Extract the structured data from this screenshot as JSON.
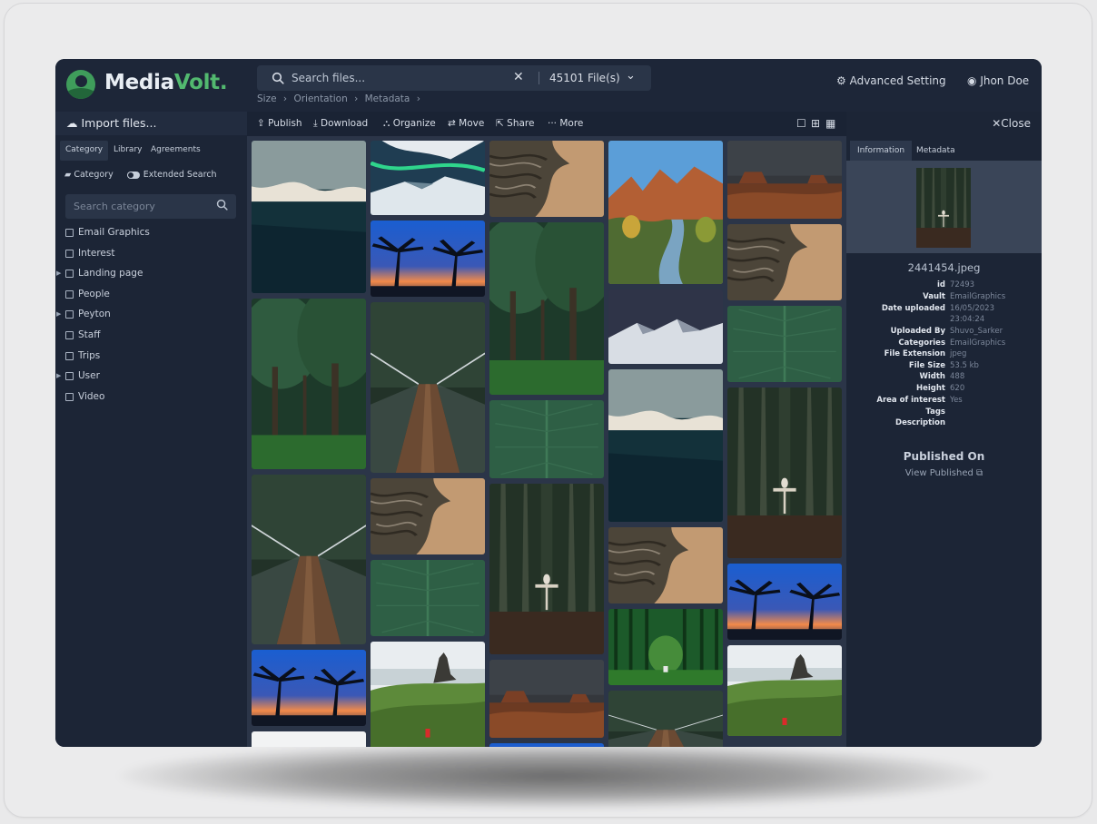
{
  "brand": {
    "part1": "Media",
    "part2": "Volt."
  },
  "search": {
    "placeholder": "Search files...",
    "count": "45101 File(s)"
  },
  "breadcrumbs": [
    "Size",
    "Orientation",
    "Metadata"
  ],
  "header": {
    "advanced": "Advanced Setting",
    "user": "Jhon Doe"
  },
  "sidebar": {
    "import": "Import files...",
    "tabs": [
      "Category",
      "Library",
      "Agreements"
    ],
    "category_label": "Category",
    "extended": "Extended Search",
    "search_placeholder": "Search category",
    "items": [
      {
        "label": "Email Graphics",
        "expandable": false
      },
      {
        "label": "Interest",
        "expandable": false
      },
      {
        "label": "Landing page",
        "expandable": true
      },
      {
        "label": "People",
        "expandable": false
      },
      {
        "label": "Peyton",
        "expandable": true
      },
      {
        "label": "Staff",
        "expandable": false
      },
      {
        "label": "Trips",
        "expandable": false
      },
      {
        "label": "User",
        "expandable": true
      },
      {
        "label": "Video",
        "expandable": false
      }
    ]
  },
  "toolbar": {
    "publish": "Publish",
    "download": "Download",
    "organize": "Organize",
    "move": "Move",
    "share": "Share",
    "more": "More"
  },
  "info": {
    "close": "Close",
    "tabs": [
      "Information",
      "Metadata"
    ],
    "filename": "2441454.jpeg",
    "fields": [
      {
        "k": "id",
        "v": "72493"
      },
      {
        "k": "Vault",
        "v": "EmailGraphics"
      },
      {
        "k": "Date uploaded",
        "v": "16/05/2023"
      },
      {
        "k": "",
        "v": "23:04:24"
      },
      {
        "k": "Uploaded By",
        "v": "Shuvo_Sarker"
      },
      {
        "k": "Categories",
        "v": "EmailGraphics"
      },
      {
        "k": "File Extension",
        "v": "jpeg"
      },
      {
        "k": "File Size",
        "v": "53.5 kb"
      },
      {
        "k": "Width",
        "v": "488"
      },
      {
        "k": "Height",
        "v": "620"
      },
      {
        "k": "Area of interest",
        "v": "Yes"
      },
      {
        "k": "Tags",
        "v": ""
      },
      {
        "k": "Description",
        "v": ""
      }
    ],
    "published_on": "Published On",
    "view_published": "View Published"
  },
  "gallery": {
    "columns": [
      [
        "aerial-ocean",
        "tree-park",
        "rope-bridge",
        "palm-sunset",
        "white"
      ],
      [
        "arctic-aurora",
        "palm-sunset",
        "rope-bridge",
        "desert-rock",
        "leaf",
        "mountain-hill"
      ],
      [
        "desert-rock",
        "tree-park",
        "leaf",
        "forest-person",
        "canyon",
        "palm-sunset"
      ],
      [
        "zion-river",
        "snow-peaks",
        "aerial-ocean",
        "desert-rock",
        "green-forest",
        "rope-bridge"
      ],
      [
        "canyon",
        "desert-rock",
        "leaf",
        "forest-person",
        "palm-sunset",
        "mountain-hill"
      ]
    ]
  }
}
